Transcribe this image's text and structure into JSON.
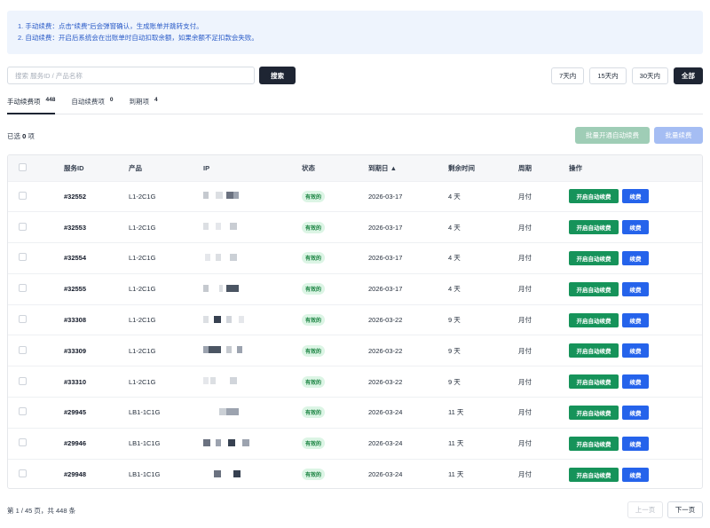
{
  "notice": {
    "line1": "1. 手动续费：点击\"续费\"后会弹窗确认，生成账单并跳转支付。",
    "line2": "2. 自动续费：开启后系统会在出账单时自动扣取余额，如果余额不足扣款会失败。"
  },
  "search": {
    "placeholder": "搜索 服务ID / 产品名称",
    "button_label": "搜索"
  },
  "filters": [
    {
      "label": "7天内",
      "active": false
    },
    {
      "label": "15天内",
      "active": false
    },
    {
      "label": "30天内",
      "active": false
    },
    {
      "label": "全部",
      "active": true
    }
  ],
  "tabs": [
    {
      "label": "手动续费项",
      "count": "448",
      "active": true
    },
    {
      "label": "自动续费项",
      "count": "0",
      "active": false
    },
    {
      "label": "到期项",
      "count": "4",
      "active": false
    }
  ],
  "selection": {
    "prefix": "已选",
    "count": "0",
    "suffix": "项"
  },
  "bulk": {
    "enable_auto_label": "批量开通自动续费",
    "renew_label": "批量续费"
  },
  "table": {
    "headers": {
      "id": "服务ID",
      "product": "产品",
      "ip": "IP",
      "status": "状态",
      "expiry": "到期日 ▲",
      "remaining": "剩余时间",
      "cycle": "周期",
      "actions": "操作"
    },
    "auto_renew_label": "开启自动续费",
    "renew_label": "续费",
    "rows": [
      {
        "id": "#32552",
        "product": "L1-2C1G",
        "status": "有效的",
        "expiry": "2026-03-17",
        "remaining": "4 天",
        "cycle": "月付"
      },
      {
        "id": "#32553",
        "product": "L1-2C1G",
        "status": "有效的",
        "expiry": "2026-03-17",
        "remaining": "4 天",
        "cycle": "月付"
      },
      {
        "id": "#32554",
        "product": "L1-2C1G",
        "status": "有效的",
        "expiry": "2026-03-17",
        "remaining": "4 天",
        "cycle": "月付"
      },
      {
        "id": "#32555",
        "product": "L1-2C1G",
        "status": "有效的",
        "expiry": "2026-03-17",
        "remaining": "4 天",
        "cycle": "月付"
      },
      {
        "id": "#33308",
        "product": "L1-2C1G",
        "status": "有效的",
        "expiry": "2026-03-22",
        "remaining": "9 天",
        "cycle": "月付"
      },
      {
        "id": "#33309",
        "product": "L1-2C1G",
        "status": "有效的",
        "expiry": "2026-03-22",
        "remaining": "9 天",
        "cycle": "月付"
      },
      {
        "id": "#33310",
        "product": "L1-2C1G",
        "status": "有效的",
        "expiry": "2026-03-22",
        "remaining": "9 天",
        "cycle": "月付"
      },
      {
        "id": "#29945",
        "product": "LB1-1C1G",
        "status": "有效的",
        "expiry": "2026-03-24",
        "remaining": "11 天",
        "cycle": "月付"
      },
      {
        "id": "#29946",
        "product": "LB1-1C1G",
        "status": "有效的",
        "expiry": "2026-03-24",
        "remaining": "11 天",
        "cycle": "月付"
      },
      {
        "id": "#29948",
        "product": "LB1-1C1G",
        "status": "有效的",
        "expiry": "2026-03-24",
        "remaining": "11 天",
        "cycle": "月付"
      }
    ]
  },
  "pager": {
    "info": "第 1 / 45 页，共 448 条",
    "prev_label": "上一页",
    "next_label": "下一页"
  }
}
